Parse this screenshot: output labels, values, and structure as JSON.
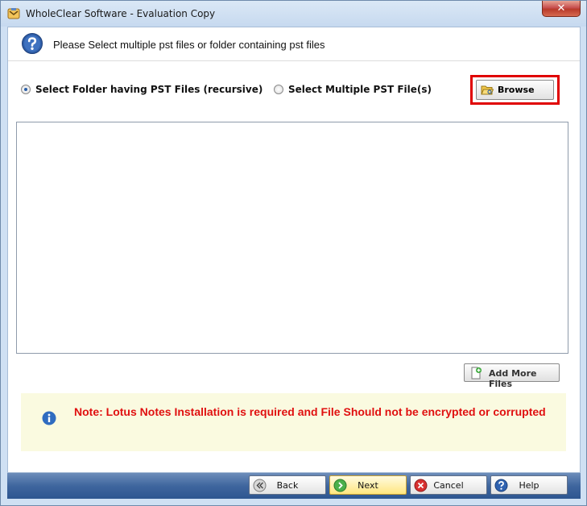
{
  "window": {
    "title": "WholeClear Software - Evaluation Copy",
    "close_label": "✕"
  },
  "header": {
    "text": "Please Select multiple pst files or folder containing pst files"
  },
  "options": {
    "folder_label": "Select Folder having PST Files (recursive)",
    "multiple_label": "Select Multiple PST File(s)",
    "selected": "folder",
    "browse_label": "Browse"
  },
  "file_list": {
    "items": []
  },
  "add_more_label": "Add More Files",
  "note": {
    "text": "Note: Lotus Notes Installation is required and File Should not be encrypted or corrupted"
  },
  "footer": {
    "back_label": "Back",
    "next_label": "Next",
    "cancel_label": "Cancel",
    "help_label": "Help"
  },
  "colors": {
    "note_text": "#e01010",
    "highlight_border": "#e00000",
    "footer_bar": "#3f669e"
  }
}
